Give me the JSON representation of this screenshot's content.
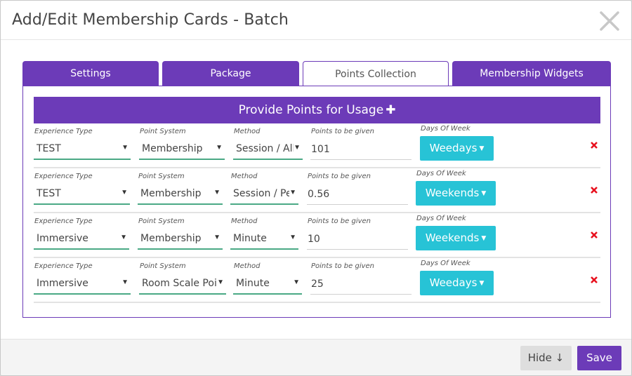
{
  "modal": {
    "title": "Add/Edit Membership Cards - Batch"
  },
  "tabs": [
    {
      "label": "Settings"
    },
    {
      "label": "Package"
    },
    {
      "label": "Points Collection"
    },
    {
      "label": "Membership Widgets"
    }
  ],
  "section": {
    "title": "Provide Points for Usage",
    "plus": "✚"
  },
  "labels": {
    "experience_type": "Experience Type",
    "point_system": "Point System",
    "method": "Method",
    "points": "Points to be given",
    "days": "Days Of Week"
  },
  "rows": [
    {
      "experience_type": "TEST",
      "point_system": "Membership",
      "method": "Session / All",
      "points": "101",
      "days": "Weedays"
    },
    {
      "experience_type": "TEST",
      "point_system": "Membership",
      "method": "Session / Pe",
      "points": "0.56",
      "days": "Weekends"
    },
    {
      "experience_type": "Immersive",
      "point_system": "Membership",
      "method": "Minute",
      "points": "10",
      "days": "Weekends"
    },
    {
      "experience_type": "Immersive",
      "point_system": "Room Scale Poi",
      "method": "Minute",
      "points": "25",
      "days": "Weedays"
    }
  ],
  "footer": {
    "hide_label": "Hide ↓",
    "save_label": "Save"
  },
  "icons": {
    "close": "close-icon",
    "caret": "caret-down-icon",
    "delete": "delete-x-icon",
    "plus": "plus-icon"
  },
  "colors": {
    "accent": "#6c3bb8",
    "info": "#27c3d6",
    "underline": "#4aa985",
    "danger": "#e8111e"
  }
}
